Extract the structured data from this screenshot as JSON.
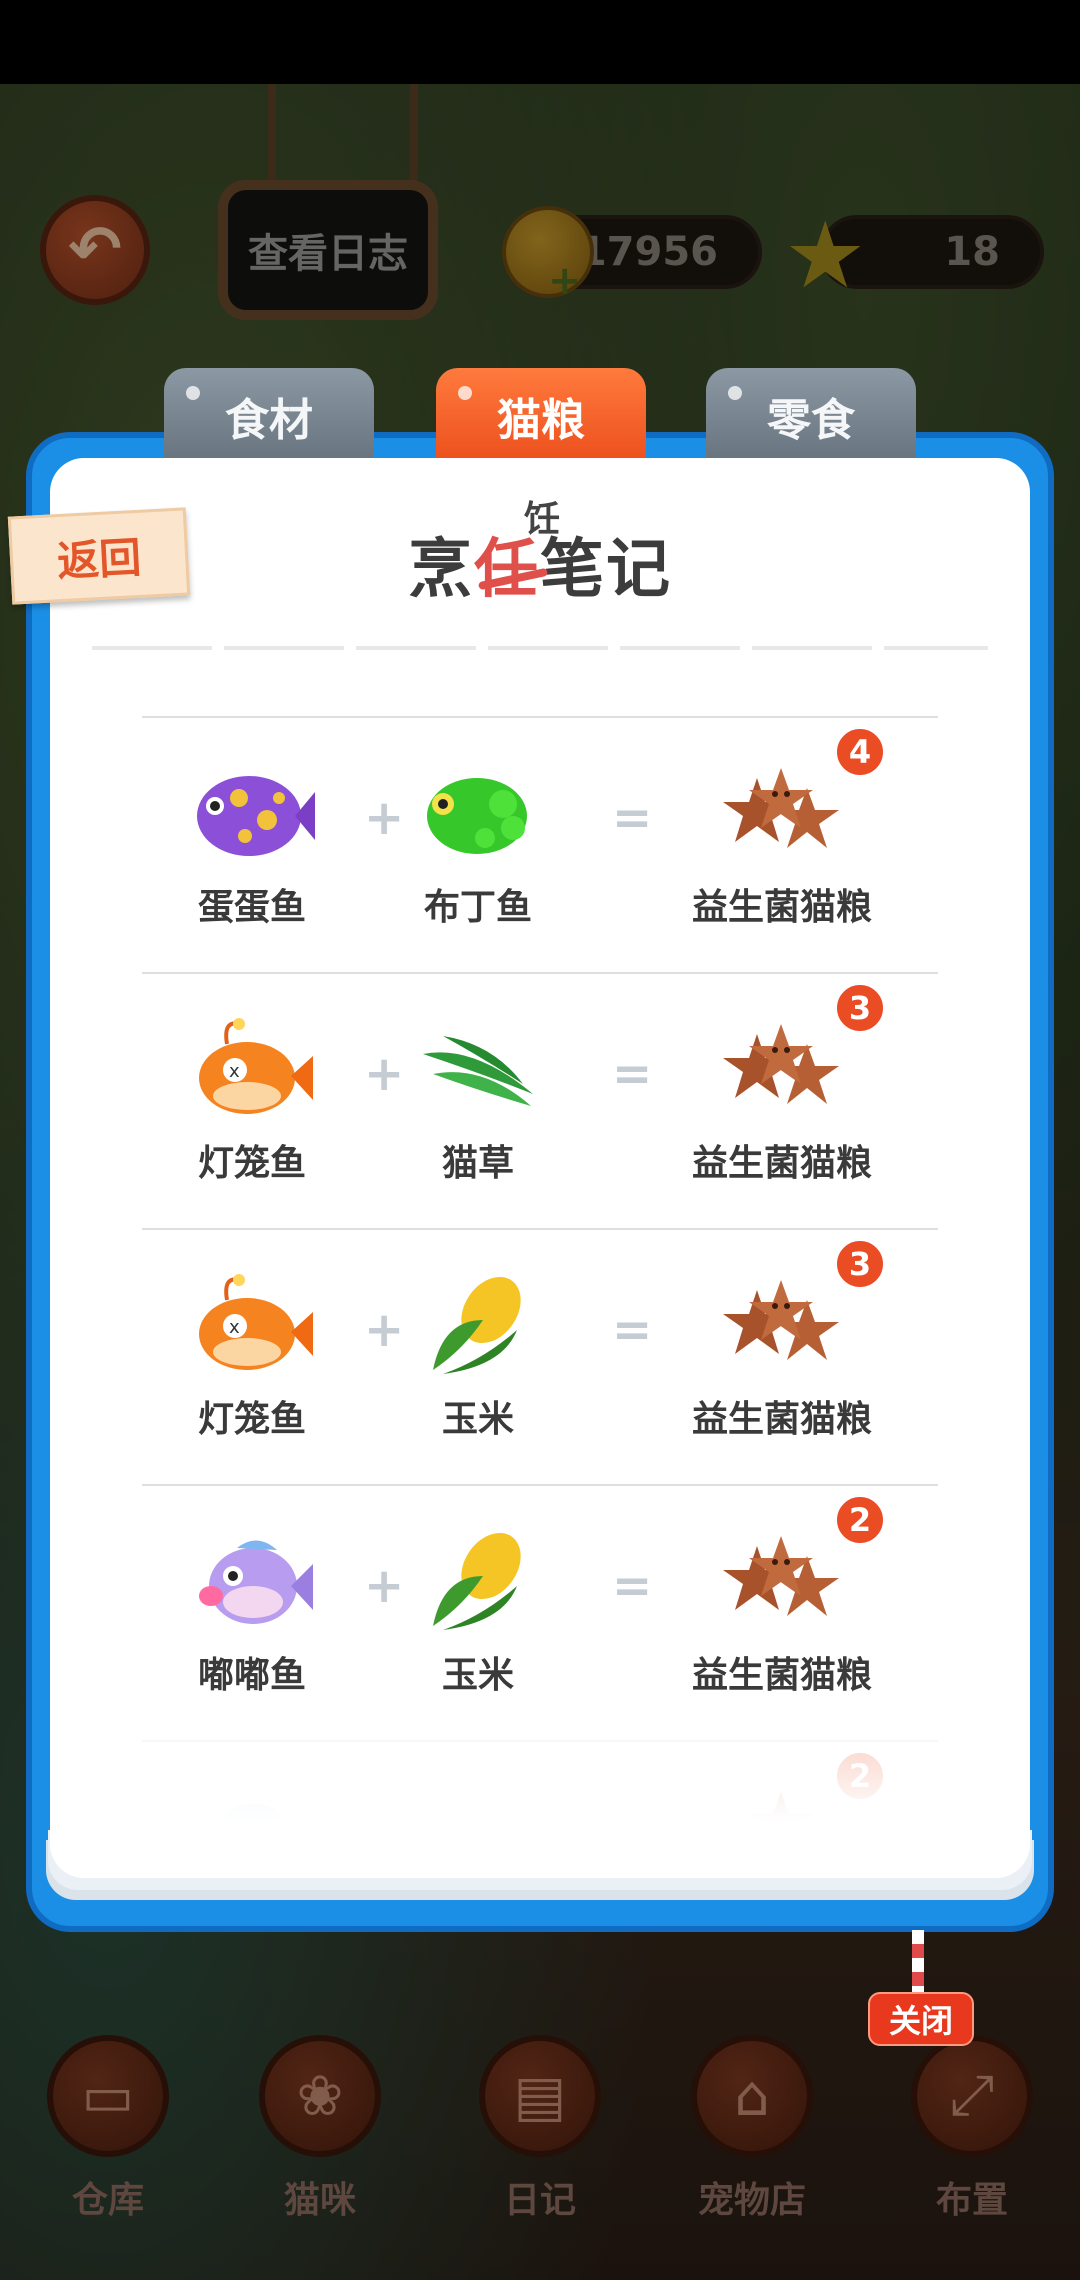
{
  "top_bar": {
    "log_button_label": "查看日志",
    "coins": "17956",
    "stars": "18"
  },
  "tabs": [
    {
      "label": "食材",
      "active": false
    },
    {
      "label": "猫粮",
      "active": true
    },
    {
      "label": "零食",
      "active": false
    }
  ],
  "dialog": {
    "return_label": "返回",
    "title": "烹饪笔记",
    "title_parts": {
      "prefix": "烹",
      "struck": "任",
      "correction": "饪",
      "suffix": "笔记"
    },
    "close_label": "关闭"
  },
  "recipes": [
    {
      "a": "蛋蛋鱼",
      "b": "布丁鱼",
      "result": "益生菌猫粮",
      "count": "4",
      "op_plus": "+",
      "op_eq": "="
    },
    {
      "a": "灯笼鱼",
      "b": "猫草",
      "result": "益生菌猫粮",
      "count": "3",
      "op_plus": "+",
      "op_eq": "="
    },
    {
      "a": "灯笼鱼",
      "b": "玉米",
      "result": "益生菌猫粮",
      "count": "3",
      "op_plus": "+",
      "op_eq": "="
    },
    {
      "a": "嘟嘟鱼",
      "b": "玉米",
      "result": "益生菌猫粮",
      "count": "2",
      "op_plus": "+",
      "op_eq": "="
    },
    {
      "count": "2"
    }
  ],
  "bottom_nav": [
    {
      "label": "仓库",
      "icon": "box-icon"
    },
    {
      "label": "猫咪",
      "icon": "paw-icon"
    },
    {
      "label": "日记",
      "icon": "notebook-icon"
    },
    {
      "label": "宠物店",
      "icon": "shop-icon"
    },
    {
      "label": "布置",
      "icon": "expand-icon"
    }
  ],
  "colors": {
    "accent": "#ec4f1c",
    "frame_blue": "#1b8fe6",
    "badge": "#ea4d24"
  }
}
